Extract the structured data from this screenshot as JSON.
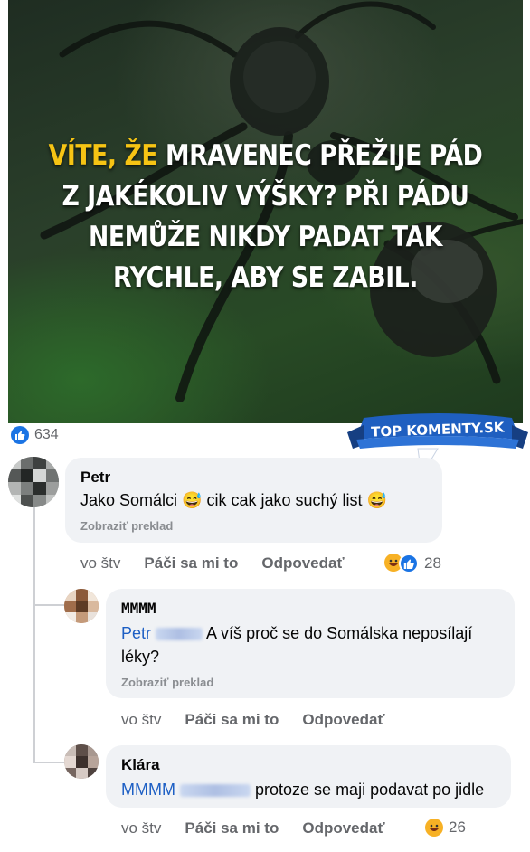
{
  "post": {
    "headline_highlight": "VÍTE, ŽE",
    "headline_rest": " MRAVENEC PŘEŽIJE PÁD Z JAKÉKOLIV VÝŠKY? PŘI PÁDU NEMŮŽE NIKDY PADAT TAK RYCHLE, ABY SE ZABIL.",
    "like_count": "634"
  },
  "badge": {
    "text": "TOP KOMENTY.SK"
  },
  "comments": [
    {
      "author": "Petr",
      "text": "Jako Somálci 😅 cik cak jako suchý list 😅",
      "text_a": "Jako Somálci",
      "text_b": "cik cak jako suchý list",
      "translate": "Zobraziť preklad",
      "time": "vo štv",
      "like_label": "Páči sa mi to",
      "reply_label": "Odpovedať",
      "reaction_count": "28",
      "reactions": [
        "laugh-emoji",
        "like-icon"
      ]
    },
    {
      "author": "MMMM",
      "mention": "Petr",
      "text": "A víš proč se do Somálska neposílají léky?",
      "text_line1": "A víš proč se do Somálska neposílají",
      "text_line2": "léky?",
      "translate": "Zobraziť preklad",
      "time": "vo štv",
      "like_label": "Páči sa mi to",
      "reply_label": "Odpovedať"
    },
    {
      "author": "Klára",
      "mention": "MMMM",
      "text": "protoze se maji podavat po jidle",
      "time": "vo štv",
      "like_label": "Páči sa mi to",
      "reply_label": "Odpovedať",
      "reaction_count": "26",
      "reactions": [
        "laugh-emoji"
      ]
    }
  ],
  "colors": {
    "highlight": "#f6c414",
    "facebook_blue": "#1b74e4",
    "bubble": "#f0f2f5",
    "secondary_text": "#65676b"
  }
}
